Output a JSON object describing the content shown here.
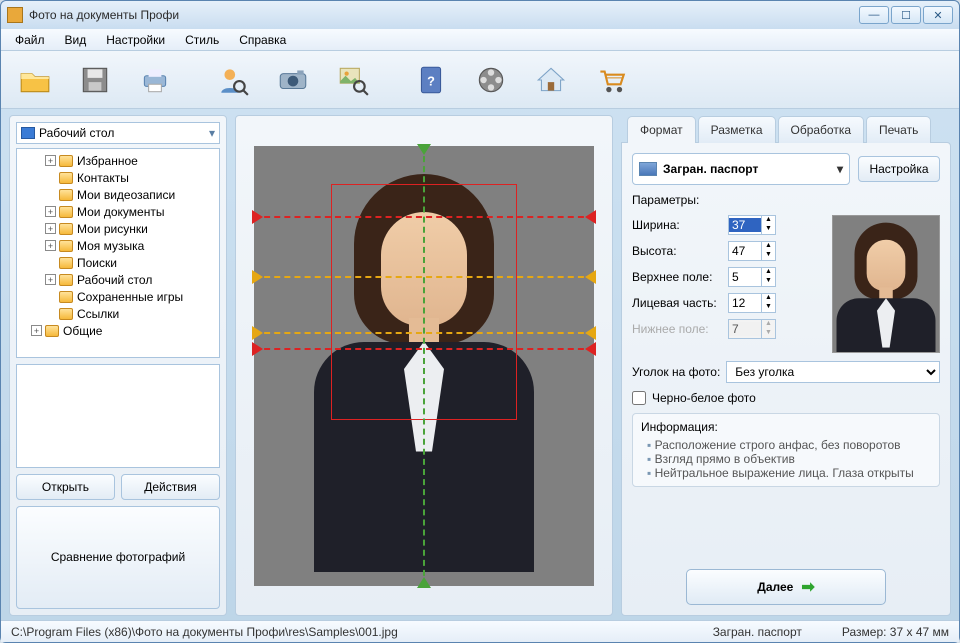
{
  "window": {
    "title": "Фото на документы Профи"
  },
  "menu": [
    "Файл",
    "Вид",
    "Настройки",
    "Стиль",
    "Справка"
  ],
  "sidebar": {
    "root": "Рабочий стол",
    "items": [
      {
        "label": "Избранное",
        "exp": "+"
      },
      {
        "label": "Контакты",
        "exp": ""
      },
      {
        "label": "Мои видеозаписи",
        "exp": ""
      },
      {
        "label": "Мои документы",
        "exp": "+"
      },
      {
        "label": "Мои рисунки",
        "exp": "+"
      },
      {
        "label": "Моя музыка",
        "exp": "+"
      },
      {
        "label": "Поиски",
        "exp": ""
      },
      {
        "label": "Рабочий стол",
        "exp": "+"
      },
      {
        "label": "Сохраненные игры",
        "exp": ""
      },
      {
        "label": "Ссылки",
        "exp": ""
      },
      {
        "label": "Общие",
        "exp": "+"
      }
    ],
    "open_btn": "Открыть",
    "actions_btn": "Действия",
    "compare_btn": "Сравнение фотографий"
  },
  "tabs": {
    "format": "Формат",
    "layout": "Разметка",
    "process": "Обработка",
    "print": "Печать"
  },
  "format": {
    "selected": "Загран. паспорт",
    "settings_btn": "Настройка",
    "params_label": "Параметры:",
    "width_label": "Ширина:",
    "width": "37",
    "height_label": "Высота:",
    "height": "47",
    "topfield_label": "Верхнее поле:",
    "topfield": "5",
    "face_label": "Лицевая часть:",
    "face": "12",
    "bottom_label": "Нижнее поле:",
    "bottom": "7",
    "corner_label": "Уголок на фото:",
    "corner_value": "Без уголка",
    "bw_label": "Черно-белое фото",
    "info_title": "Информация:",
    "info_items": [
      "Расположение строго анфас, без поворотов",
      "Взгляд прямо в объектив",
      "Нейтральное выражение лица. Глаза открыты"
    ],
    "next_btn": "Далее"
  },
  "status": {
    "path": "C:\\Program Files (x86)\\Фото на документы Профи\\res\\Samples\\001.jpg",
    "fmt": "Загран. паспорт",
    "size": "Размер: 37 x 47 мм"
  }
}
